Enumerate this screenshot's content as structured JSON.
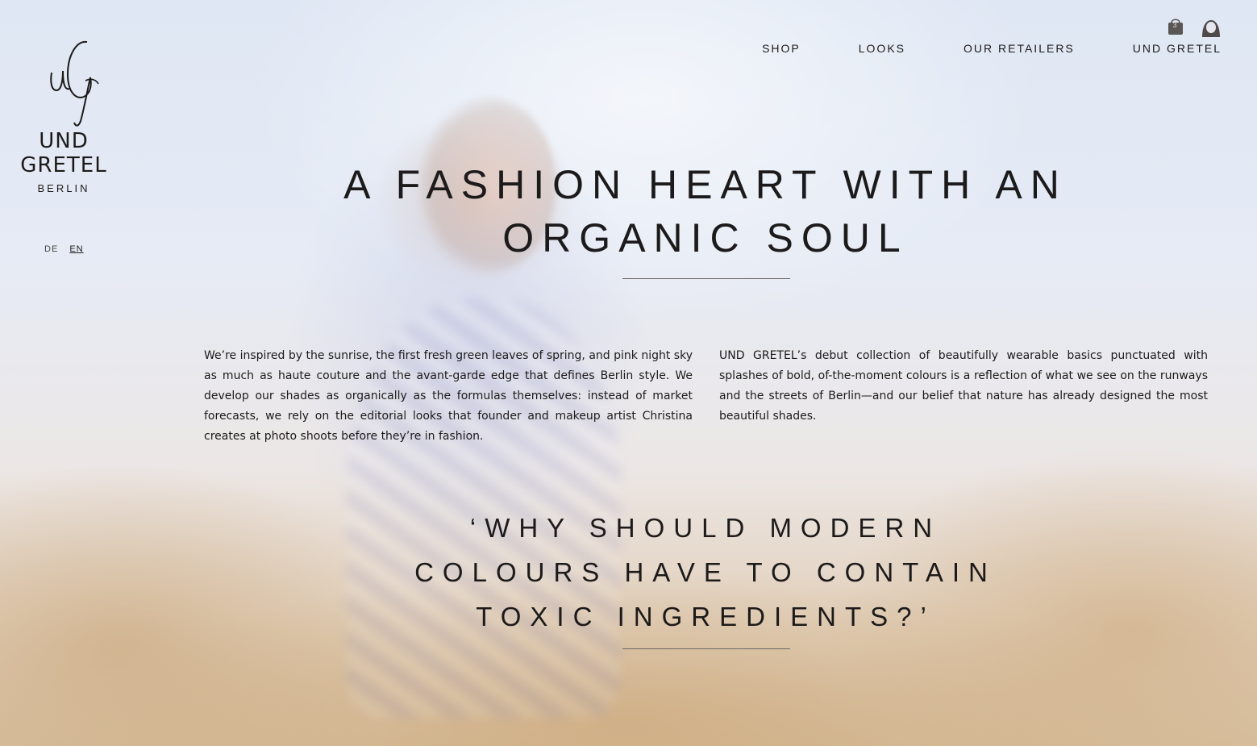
{
  "brand": {
    "monogram": "uG",
    "line1": "UND",
    "line2": "GRETEL",
    "city": "BERLIN"
  },
  "language": {
    "options": [
      "DE",
      "EN"
    ],
    "active": "EN"
  },
  "nav": {
    "items": [
      "SHOP",
      "LOOKS",
      "OUR RETAILERS",
      "UND GRETEL"
    ]
  },
  "cart": {
    "count": "3"
  },
  "hero": {
    "headline": "A FASHION HEART WITH AN ORGANIC SOUL"
  },
  "body": {
    "left": "We’re inspired by the sunrise, the first fresh green leaves of spring, and pink night sky as much as haute couture and the avant-garde edge that defines Berlin style. We develop our shades as organically as the formulas themselves: instead of market forecasts, we rely on the editorial looks that founder and makeup artist Christina creates at photo shoots before they’re in fashion.",
    "right": "UND GRETEL’s debut collection of beautifully wearable basics punctuated with splashes of bold, of-the-moment colours is a reflection of what we see on the runways and the streets of Berlin—and our belief that nature has already designed the most beautiful shades."
  },
  "quote": {
    "lines": [
      "‘WHY SHOULD MODERN",
      "COLOURS HAVE TO CONTAIN",
      "TOXIC INGREDIENTS?’"
    ]
  }
}
